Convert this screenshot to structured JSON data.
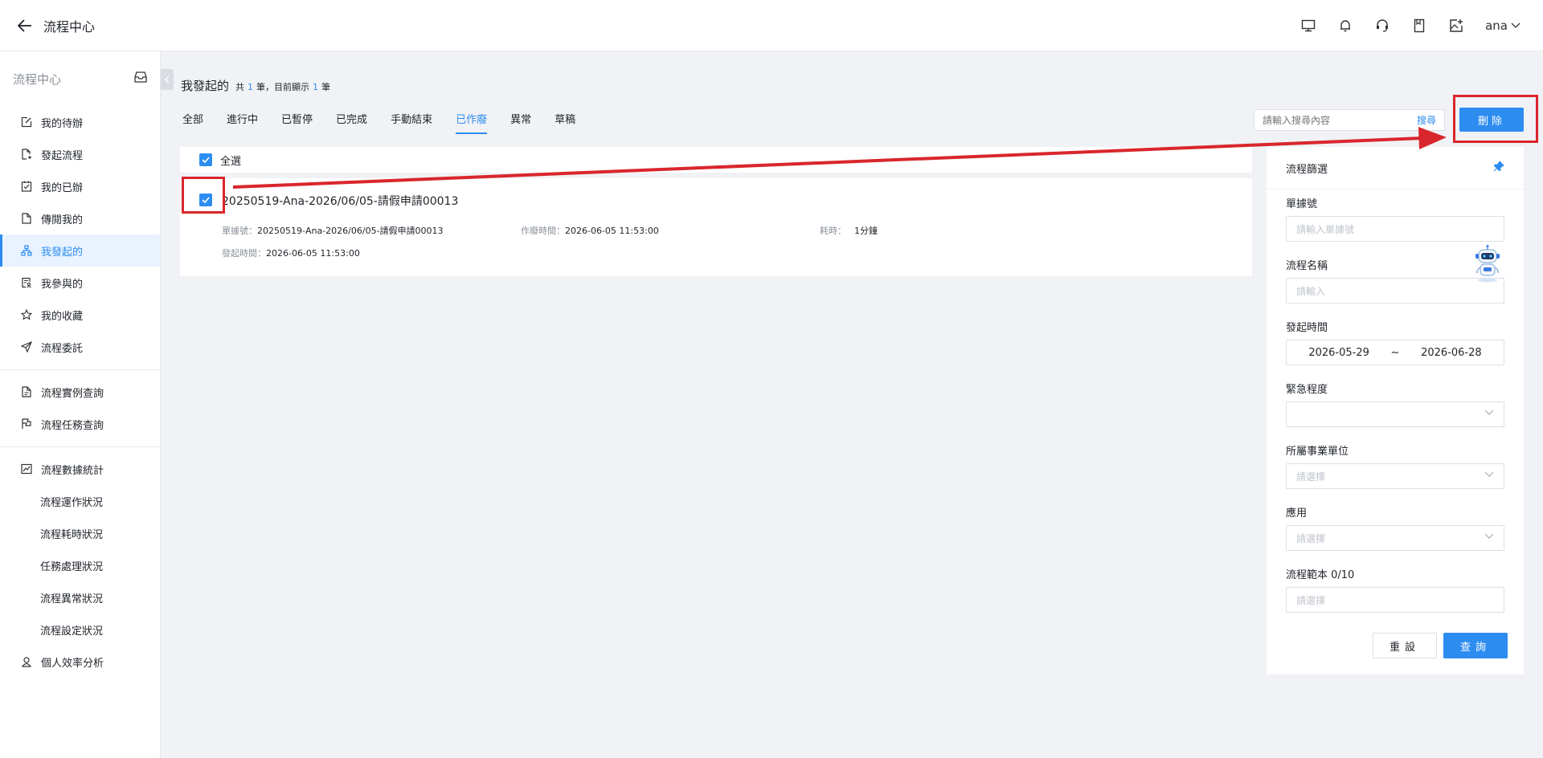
{
  "topbar": {
    "title": "流程中心",
    "user": "ana",
    "icons": [
      "monitor-icon",
      "bell-icon",
      "headset-icon",
      "bookmark-icon",
      "image-icon"
    ]
  },
  "sidebar": {
    "header": "流程中心",
    "items": [
      {
        "label": "我的待辦",
        "icon": "edit-icon"
      },
      {
        "label": "發起流程",
        "icon": "file-add-icon"
      },
      {
        "label": "我的已辦",
        "icon": "check-square-icon"
      },
      {
        "label": "傳閱我的",
        "icon": "file-icon"
      },
      {
        "label": "我發起的",
        "icon": "flow-icon"
      },
      {
        "label": "我參與的",
        "icon": "doc-user-icon"
      },
      {
        "label": "我的收藏",
        "icon": "star-icon"
      },
      {
        "label": "流程委託",
        "icon": "send-icon"
      },
      {
        "label": "流程實例查詢",
        "icon": "file-search-icon"
      },
      {
        "label": "流程任務查詢",
        "icon": "flag-icon"
      },
      {
        "label": "流程數據統計",
        "icon": "chart-icon"
      },
      {
        "label": "流程運作狀況"
      },
      {
        "label": "流程耗時狀況"
      },
      {
        "label": "任務處理狀況"
      },
      {
        "label": "流程異常狀況"
      },
      {
        "label": "流程設定狀況"
      },
      {
        "label": "個人效率分析",
        "icon": "user-icon"
      }
    ]
  },
  "main": {
    "title": "我發起的",
    "count_prefix": "共",
    "count_total": "1",
    "count_mid": "筆，目前顯示",
    "count_shown": "1",
    "count_suffix": "筆",
    "tabs": [
      "全部",
      "進行中",
      "已暫停",
      "已完成",
      "手動結束",
      "已作廢",
      "異常",
      "草稿"
    ],
    "search_placeholder": "請輸入搜尋內容",
    "search_button": "搜尋",
    "delete_button": "刪除",
    "select_all": "全選",
    "record": {
      "title": "20250519-Ana-2026/06/05-請假申請00013",
      "order_label": "單據號：",
      "order_value": "20250519-Ana-2026/06/05-請假申請00013",
      "void_label": "作廢時間：",
      "void_value": "2026-06-05 11:53:00",
      "duration_label": "耗時：",
      "duration_value": "1分鐘",
      "start_label": "發起時間：",
      "start_value": "2026-06-05 11:53:00"
    }
  },
  "filter": {
    "title": "流程篩選",
    "order_label": "單據號",
    "order_placeholder": "請輸入單據號",
    "name_label": "流程名稱",
    "name_placeholder": "請輸入",
    "time_label": "發起時間",
    "time_from": "2026-05-29",
    "time_sep": "~",
    "time_to": "2026-06-28",
    "urgency_label": "緊急程度",
    "unit_label": "所屬事業單位",
    "unit_placeholder": "請選擇",
    "app_label": "應用",
    "app_placeholder": "請選擇",
    "template_label": "流程範本 0/10",
    "template_placeholder": "請選擇",
    "reset_button": "重設",
    "query_button": "查詢"
  },
  "colors": {
    "accent": "#2d8cf0",
    "annotation": "#d9262c"
  }
}
